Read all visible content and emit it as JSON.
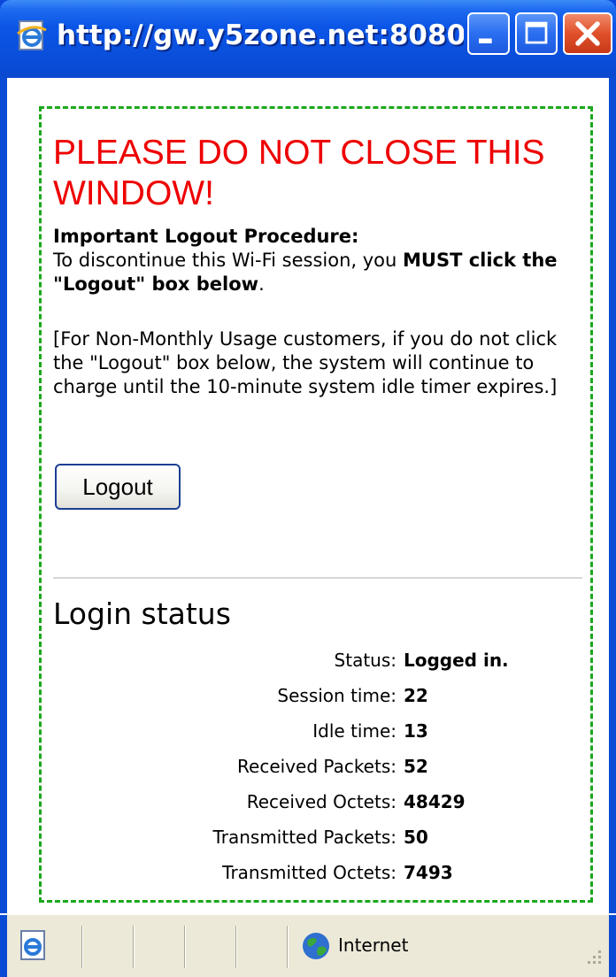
{
  "window": {
    "title": "http://gw.y5zone.net:8080 ...",
    "title_icon": "ie-page-icon",
    "buttons": {
      "minimize": "minimize-icon",
      "maximize": "maximize-icon",
      "close": "close-icon"
    }
  },
  "content": {
    "warning_heading": "PLEASE DO NOT CLOSE THIS WINDOW!",
    "procedure_title": "Important Logout Procedure:",
    "procedure_text_1": "To discontinue this Wi-Fi session, you ",
    "procedure_bold": "MUST click the \"Logout\" box below",
    "procedure_text_2": ".",
    "note": "[For Non-Monthly Usage customers, if you do not click the \"Logout\" box below, the system will continue to charge until the 10-minute system idle timer expires.]",
    "logout_label": "Logout"
  },
  "login_status": {
    "title": "Login status",
    "rows": [
      {
        "label": "Status:",
        "value": "Logged in."
      },
      {
        "label": "Session time:",
        "value": "22"
      },
      {
        "label": "Idle time:",
        "value": "13"
      },
      {
        "label": "Received Packets:",
        "value": "52"
      },
      {
        "label": "Received Octets:",
        "value": "48429"
      },
      {
        "label": "Transmitted Packets:",
        "value": "50"
      },
      {
        "label": "Transmitted Octets:",
        "value": "7493"
      }
    ]
  },
  "statusbar": {
    "page_icon": "ie-page-icon",
    "zone_icon": "globe-icon",
    "zone_label": "Internet"
  },
  "colors": {
    "titlebar": "#0a55e6",
    "warning": "#ee0000",
    "dashed_border": "#1ca81c",
    "statusbar_bg": "#ece9d8"
  }
}
